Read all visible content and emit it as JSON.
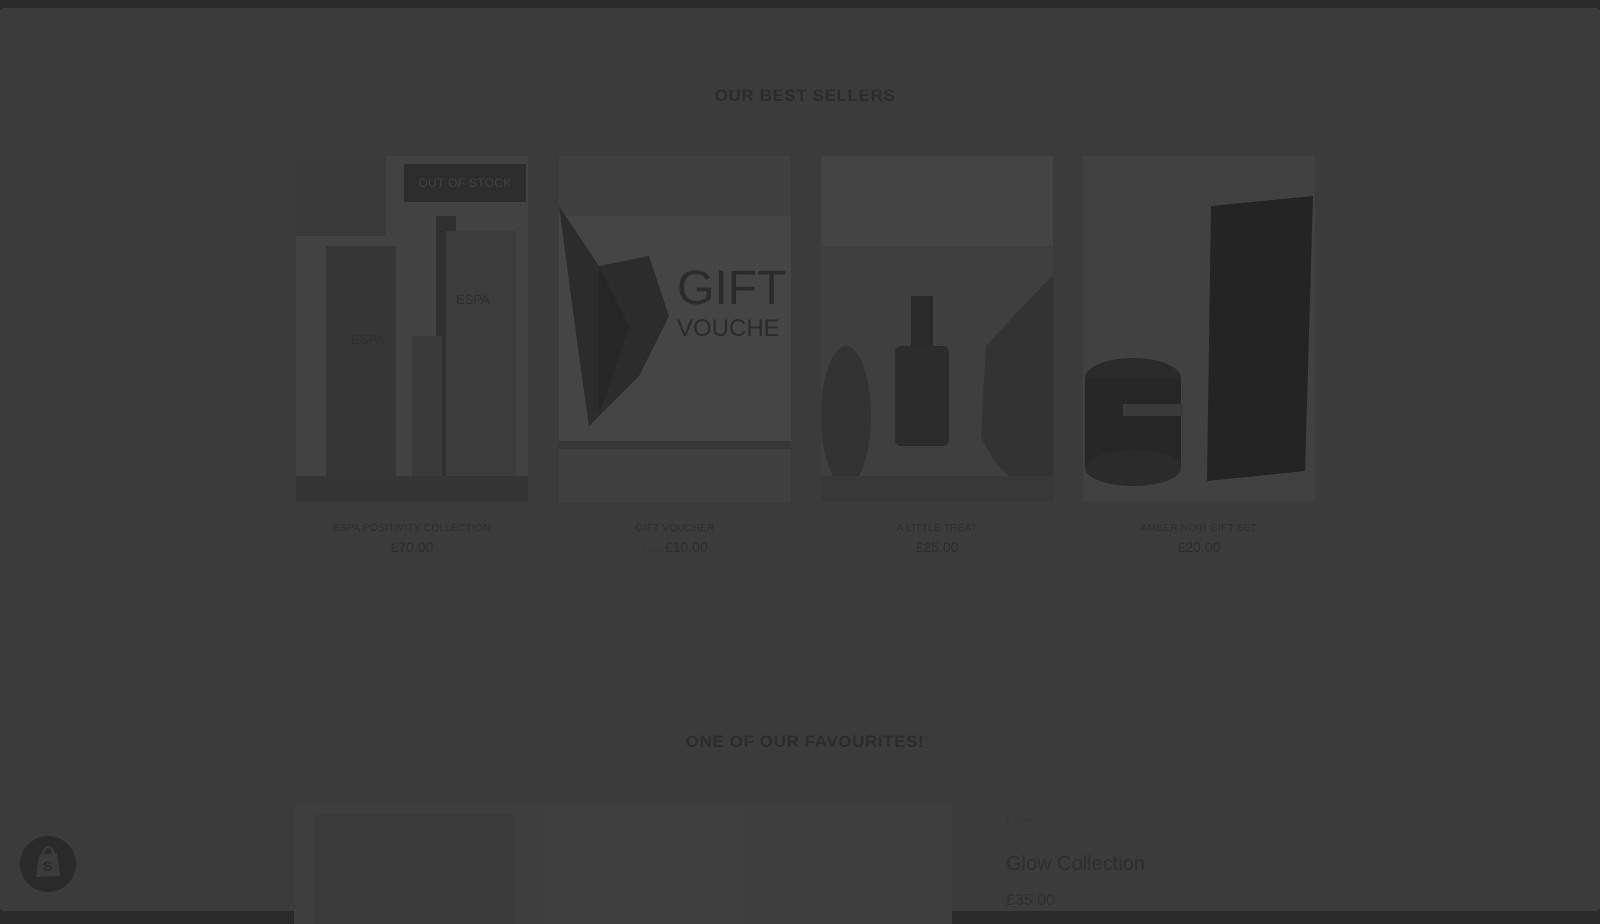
{
  "best_sellers": {
    "title": "OUR BEST SELLERS",
    "products": [
      {
        "name": "ESPA POSITIVITY COLLECTION",
        "price": "£70.00",
        "badge": "OUT OF STOCK",
        "image_text": [
          "ESPA",
          "ESPA"
        ]
      },
      {
        "name": "GIFT VOUCHER",
        "old_price": "From",
        "price": "£10.00",
        "image_text": [
          "GIFT",
          "VOUCHE"
        ]
      },
      {
        "name": "A LITTLE TREAT",
        "price": "£25.00"
      },
      {
        "name": "AMBER NOIR GIFT SET",
        "price": "£20.00"
      }
    ]
  },
  "favourites": {
    "title": "ONE OF OUR FAVOURITES!",
    "vendor": "ESPA",
    "product_title": "Glow Collection",
    "price": "£35.00"
  },
  "icons": {
    "shop": "shopify-bag-icon"
  }
}
